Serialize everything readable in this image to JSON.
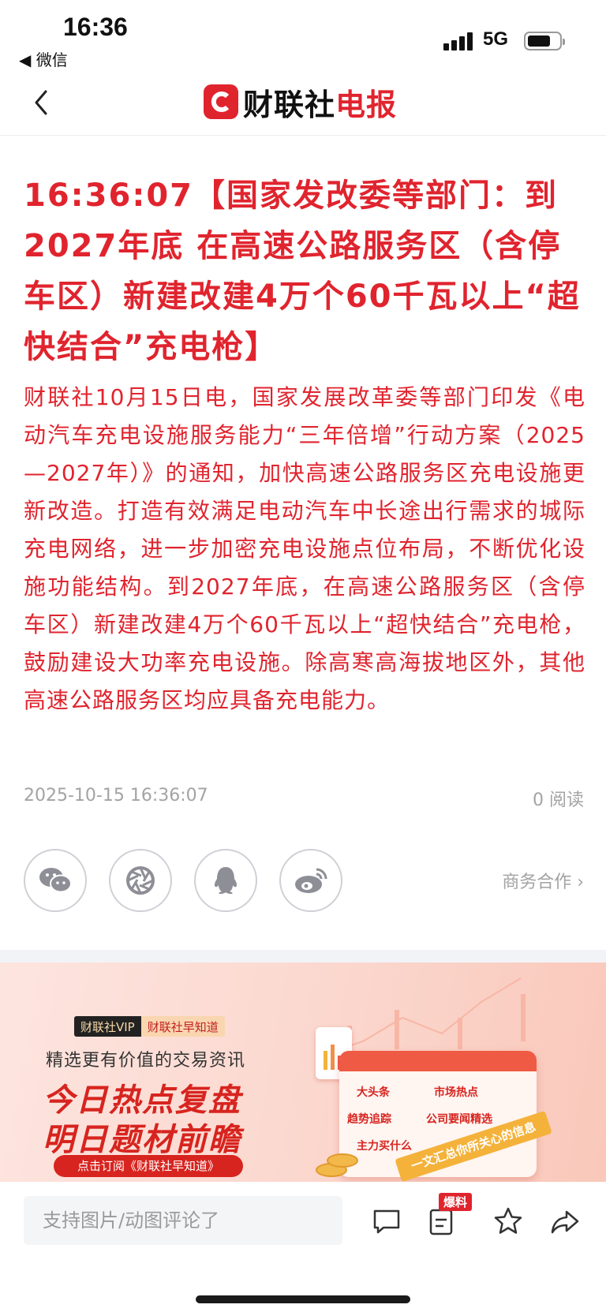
{
  "status_bar": {
    "time": "16:36",
    "back_app": "◀ 微信",
    "network": "5G"
  },
  "nav": {
    "logo_brand": "财联社",
    "logo_suffix": "电报"
  },
  "article": {
    "headline": "16:36:07【国家发改委等部门：到2027年底 在高速公路服务区（含停车区）新建改建4万个60千瓦以上“超快结合”充电枪】",
    "body": "财联社10月15日电，国家发展改革委等部门印发《电动汽车充电设施服务能力“三年倍增”行动方案（2025—2027年）》的通知，加快高速公路服务区充电设施更新改造。打造有效满足电动汽车中长途出行需求的城际充电网络，进一步加密充电设施点位布局，不断优化设施功能结构。到2027年底，在高速公路服务区（含停车区）新建改建4万个60千瓦以上“超快结合”充电枪，鼓励建设大功率充电设施。除高寒高海拔地区外，其他高速公路服务区均应具备充电能力。",
    "datetime": "2025-10-15 16:36:07",
    "reads": "0 阅读"
  },
  "share": {
    "business": "商务合作 ›",
    "icons": [
      "wechat-icon",
      "moments-icon",
      "qq-icon",
      "weibo-icon"
    ]
  },
  "banner": {
    "tag_vip": "财联社VIP",
    "tag_product": "财联社早知道",
    "subtitle": "精选更有价值的交易资讯",
    "headline1": "今日热点复盘",
    "headline2": "明日题材前瞻",
    "cta": "点击订阅《财联社早知道》",
    "calendar_items": [
      "大头条",
      "市场热点",
      "趋势追踪",
      "公司要闻精选",
      "主力买什么"
    ],
    "ribbon": "一文汇总你所关心的信息"
  },
  "bottom_bar": {
    "comment_placeholder": "支持图片/动图评论了",
    "baoliao_badge": "爆料"
  },
  "colors": {
    "accent_red": "#e0242e",
    "banner_red": "#d7241f",
    "meta_gray": "#a3a3a3"
  }
}
